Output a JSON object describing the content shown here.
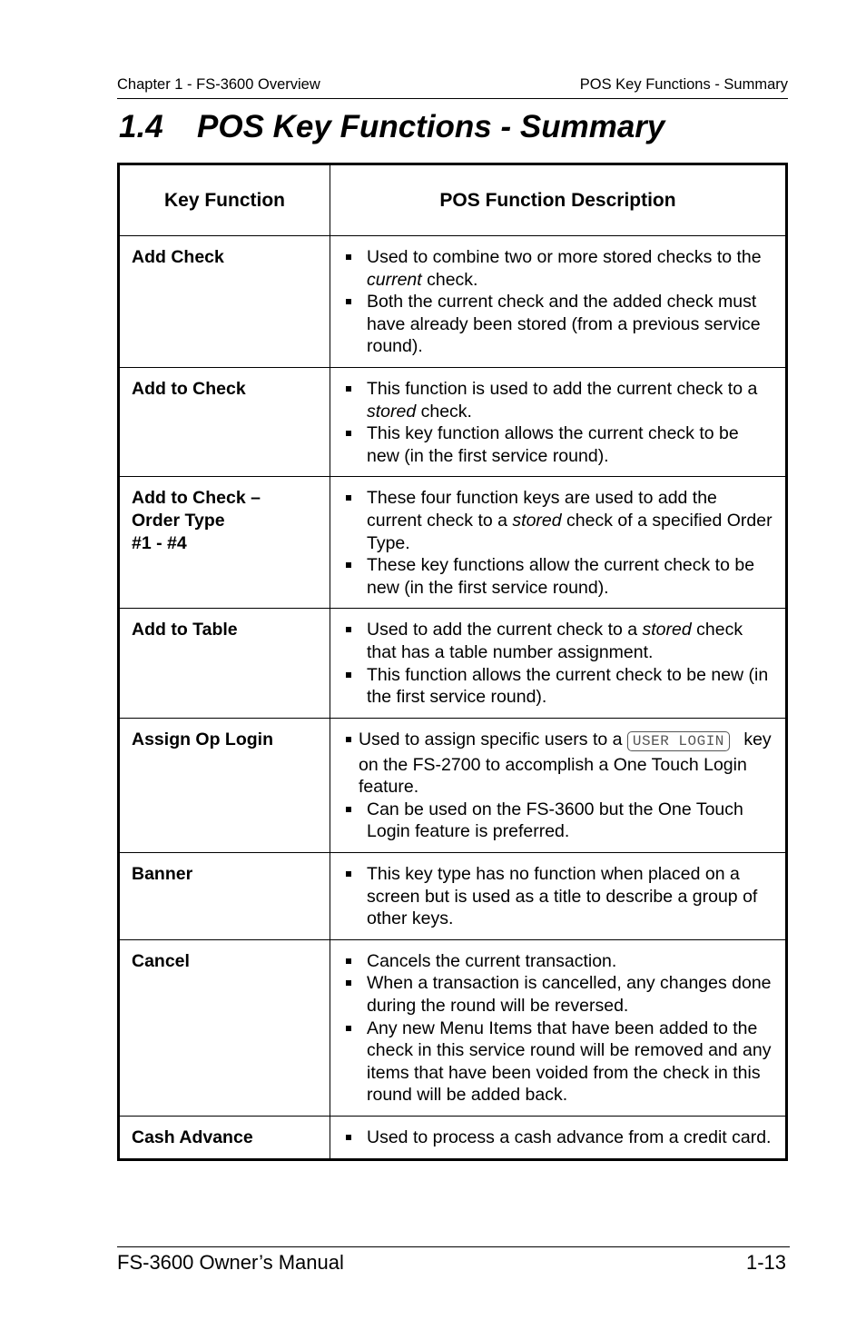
{
  "header": {
    "left": "Chapter 1 - FS-3600 Overview",
    "right": "POS Key Functions - Summary"
  },
  "section": {
    "number": "1.4",
    "title": "POS Key Functions - Summary"
  },
  "table": {
    "columns": [
      "Key Function",
      "POS Function Description"
    ],
    "rows": [
      {
        "key": "Add Check",
        "bullets": [
          [
            "Used to combine two or more stored checks to the ",
            {
              "i": "current"
            },
            " check."
          ],
          [
            "Both the current check and the added check must have already been stored (from a previous service round)."
          ]
        ]
      },
      {
        "key": "Add to Check",
        "bullets": [
          [
            "This function is used to add the current check to a ",
            {
              "i": "stored"
            },
            " check."
          ],
          [
            "This key function allows the current check to be new (in the first service round)."
          ]
        ]
      },
      {
        "key": "Add to Check –\nOrder Type\n#1 - #4",
        "bullets": [
          [
            "These four function keys are used to add the current check to a ",
            {
              "i": "stored"
            },
            " check of a specified Order Type."
          ],
          [
            "These key functions allow the current check to be new (in the first service round)."
          ]
        ]
      },
      {
        "key": "Add to Table",
        "bullets": [
          [
            "Used to add the current check to a ",
            {
              "i": "stored"
            },
            " check that has a table number assignment."
          ],
          [
            "This function allows the current check to be new (in the first service round)."
          ]
        ]
      },
      {
        "key": "Assign Op Login",
        "bullets": [
          [
            "Used to assign specific users to a ",
            {
              "k": "USER LOGIN"
            },
            " key on the FS-2700 to accomplish a One Touch Login feature."
          ],
          [
            "Can be used on the FS-3600 but the One Touch Login feature is preferred."
          ]
        ],
        "tight_first": true
      },
      {
        "key": "Banner",
        "bullets": [
          [
            "This key type has no function when placed on a screen but is used as a title to describe a group of other keys."
          ]
        ]
      },
      {
        "key": "Cancel",
        "bullets": [
          [
            "Cancels the current transaction."
          ],
          [
            "When a transaction is cancelled, any changes done during the round will be reversed."
          ],
          [
            "Any new Menu Items that have been added to the check in this service round will be removed and any items that have been voided from the check in this round will be added back."
          ]
        ]
      },
      {
        "key": "Cash Advance",
        "bullets": [
          [
            "Used to process a cash advance from a credit card."
          ]
        ]
      }
    ]
  },
  "footer": {
    "left": "FS-3600 Owner’s Manual",
    "right": "1-13"
  }
}
